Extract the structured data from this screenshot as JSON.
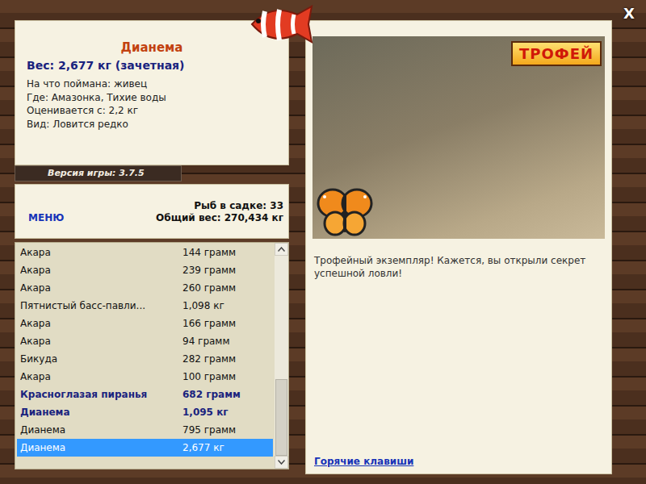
{
  "window": {
    "close": "X"
  },
  "fish_card": {
    "name": "Дианема",
    "weight_line": "Вес: 2,677 кг (зачетная)",
    "details": [
      "На что поймана: живец",
      "Где: Амазонка, Тихие воды",
      "Оценивается с: 2,2 кг",
      "Вид: Ловится редко"
    ]
  },
  "version": "Версия игры: 3.7.5",
  "menu_button": "МЕНЮ",
  "summary": {
    "count": "Рыб в садке: 33",
    "total": "Общий вес: 270,434 кг"
  },
  "catch_list": {
    "rows": [
      {
        "name": "Акара",
        "weight": "144 грамм",
        "trophy": false,
        "selected": false
      },
      {
        "name": "Акара",
        "weight": "239 грамм",
        "trophy": false,
        "selected": false
      },
      {
        "name": "Акара",
        "weight": "260 грамм",
        "trophy": false,
        "selected": false
      },
      {
        "name": "Пятнистый басс-павли...",
        "weight": "1,098 кг",
        "trophy": false,
        "selected": false
      },
      {
        "name": "Акара",
        "weight": "166 грамм",
        "trophy": false,
        "selected": false
      },
      {
        "name": "Акара",
        "weight": "94 грамм",
        "trophy": false,
        "selected": false
      },
      {
        "name": "Бикуда",
        "weight": "282 грамм",
        "trophy": false,
        "selected": false
      },
      {
        "name": "Акара",
        "weight": "100 грамм",
        "trophy": false,
        "selected": false
      },
      {
        "name": "Красноглазая пиранья",
        "weight": "682 грамм",
        "trophy": true,
        "selected": false
      },
      {
        "name": "Дианема",
        "weight": "1,095 кг",
        "trophy": true,
        "selected": false
      },
      {
        "name": "Дианема",
        "weight": "795 грамм",
        "trophy": false,
        "selected": false
      },
      {
        "name": "Дианема",
        "weight": "2,677 кг",
        "trophy": false,
        "selected": true
      }
    ],
    "scrollbar": {
      "level": 1
    }
  },
  "trophy_view": {
    "badge": "ТРОФЕЙ",
    "message": "Трофейный экземпляр! Кажется, вы открыли секрет успешной ловли!"
  },
  "hotkeys_link": "Горячие клавиши"
}
